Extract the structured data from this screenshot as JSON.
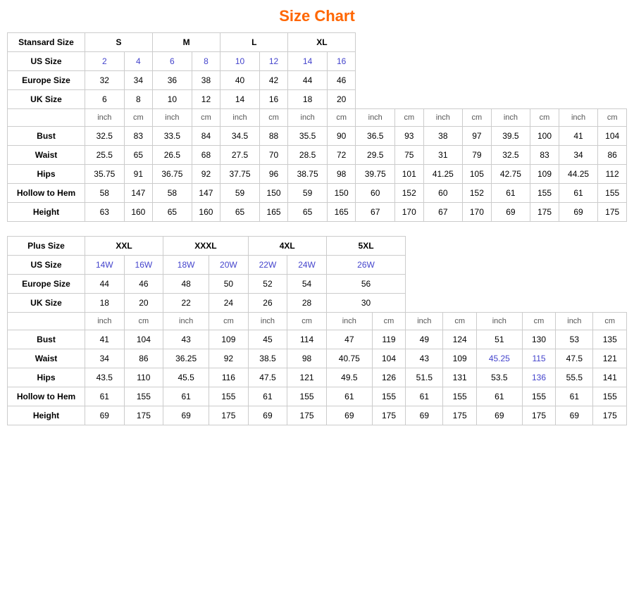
{
  "title": "Size Chart",
  "standard": {
    "label": "Stansard Size",
    "sizes": [
      "S",
      "M",
      "L",
      "XL"
    ],
    "us_label": "US Size",
    "us_values": [
      "2",
      "4",
      "6",
      "8",
      "10",
      "12",
      "14",
      "16"
    ],
    "europe_label": "Europe Size",
    "europe_values": [
      "32",
      "34",
      "36",
      "38",
      "40",
      "42",
      "44",
      "46"
    ],
    "uk_label": "UK Size",
    "uk_values": [
      "6",
      "8",
      "10",
      "12",
      "14",
      "16",
      "18",
      "20"
    ],
    "unit_inch": "inch",
    "unit_cm": "cm",
    "measurements": [
      {
        "label": "Bust",
        "values": [
          "32.5",
          "83",
          "33.5",
          "84",
          "34.5",
          "88",
          "35.5",
          "90",
          "36.5",
          "93",
          "38",
          "97",
          "39.5",
          "100",
          "41",
          "104"
        ]
      },
      {
        "label": "Waist",
        "values": [
          "25.5",
          "65",
          "26.5",
          "68",
          "27.5",
          "70",
          "28.5",
          "72",
          "29.5",
          "75",
          "31",
          "79",
          "32.5",
          "83",
          "34",
          "86"
        ]
      },
      {
        "label": "Hips",
        "values": [
          "35.75",
          "91",
          "36.75",
          "92",
          "37.75",
          "96",
          "38.75",
          "98",
          "39.75",
          "101",
          "41.25",
          "105",
          "42.75",
          "109",
          "44.25",
          "112"
        ]
      },
      {
        "label": "Hollow to Hem",
        "values": [
          "58",
          "147",
          "58",
          "147",
          "59",
          "150",
          "59",
          "150",
          "60",
          "152",
          "60",
          "152",
          "61",
          "155",
          "61",
          "155"
        ]
      },
      {
        "label": "Height",
        "values": [
          "63",
          "160",
          "65",
          "160",
          "65",
          "165",
          "65",
          "165",
          "67",
          "170",
          "67",
          "170",
          "69",
          "175",
          "69",
          "175"
        ]
      }
    ]
  },
  "plus": {
    "label": "Plus Size",
    "sizes": [
      "XXL",
      "XXXL",
      "4XL",
      "5XL"
    ],
    "us_label": "US Size",
    "us_values": [
      "14W",
      "16W",
      "18W",
      "20W",
      "22W",
      "24W",
      "26W"
    ],
    "europe_label": "Europe Size",
    "europe_values": [
      "44",
      "46",
      "48",
      "50",
      "52",
      "54",
      "56"
    ],
    "uk_label": "UK Size",
    "uk_values": [
      "18",
      "20",
      "22",
      "24",
      "26",
      "28",
      "30"
    ],
    "unit_inch": "inch",
    "unit_cm": "cm",
    "measurements": [
      {
        "label": "Bust",
        "values": [
          "41",
          "104",
          "43",
          "109",
          "45",
          "114",
          "47",
          "119",
          "49",
          "124",
          "51",
          "130",
          "53",
          "135"
        ]
      },
      {
        "label": "Waist",
        "values": [
          "34",
          "86",
          "36.25",
          "92",
          "38.5",
          "98",
          "40.75",
          "104",
          "43",
          "109",
          "45.25",
          "115",
          "47.5",
          "121"
        ]
      },
      {
        "label": "Hips",
        "values": [
          "43.5",
          "110",
          "45.5",
          "116",
          "47.5",
          "121",
          "49.5",
          "126",
          "51.5",
          "131",
          "53.5",
          "136",
          "55.5",
          "141"
        ]
      },
      {
        "label": "Hollow to Hem",
        "values": [
          "61",
          "155",
          "61",
          "155",
          "61",
          "155",
          "61",
          "155",
          "61",
          "155",
          "61",
          "155",
          "61",
          "155"
        ]
      },
      {
        "label": "Height",
        "values": [
          "69",
          "175",
          "69",
          "175",
          "69",
          "175",
          "69",
          "175",
          "69",
          "175",
          "69",
          "175",
          "69",
          "175"
        ]
      }
    ]
  }
}
